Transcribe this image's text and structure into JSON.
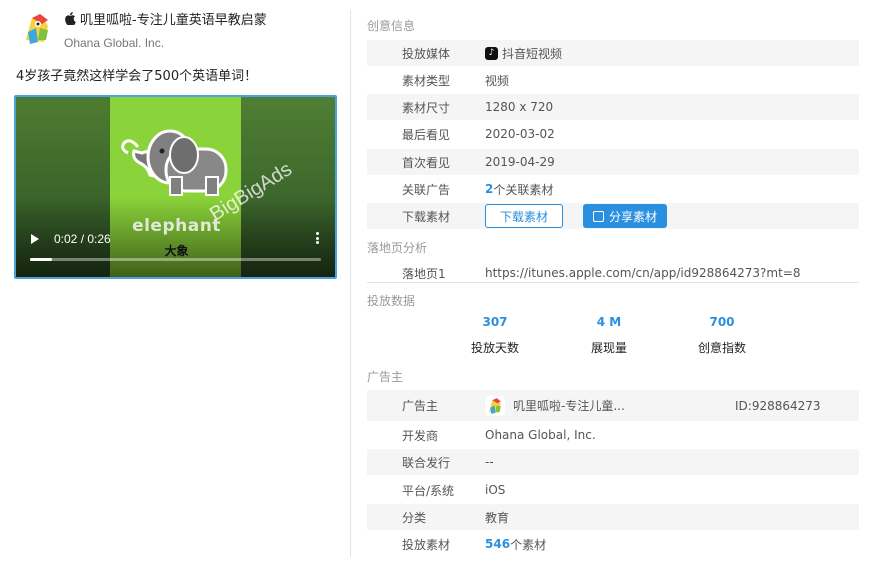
{
  "app": {
    "title": "叽里呱啦-专注儿童英语早教启蒙",
    "developer": "Ohana Global. Inc.",
    "ad_title": "4岁孩子竟然这样学会了500个英语单词！"
  },
  "video": {
    "time": "0:02 / 0:26",
    "progress": 0.077,
    "word_en": "elephant",
    "word_zh": "大象",
    "watermark": "BigBigAds"
  },
  "creative": {
    "section_title": "创意信息",
    "rows": [
      {
        "label": "投放媒体",
        "value": "抖音短视频"
      },
      {
        "label": "素材类型",
        "value": "视频"
      },
      {
        "label": "素材尺寸",
        "value": "1280 x 720"
      },
      {
        "label": "最后看见",
        "value": "2020-03-02"
      },
      {
        "label": "首次看见",
        "value": "2019-04-29"
      },
      {
        "label": "关联广告",
        "count": "2",
        "suffix": "个关联素材"
      },
      {
        "label": "下载素材",
        "download_btn": "下载素材",
        "share_btn": "分享素材"
      }
    ]
  },
  "landing": {
    "section_title": "落地页分析",
    "label": "落地页1",
    "url": "https://itunes.apple.com/cn/app/id928864273?mt=8"
  },
  "delivery": {
    "section_title": "投放数据",
    "stats": [
      {
        "value": "307",
        "label": "投放天数"
      },
      {
        "value": "4 M",
        "label": "展现量"
      },
      {
        "value": "700",
        "label": "创意指数"
      }
    ]
  },
  "advertiser": {
    "section_title": "广告主",
    "rows": [
      {
        "label": "广告主",
        "value": "叽里呱啦-专注儿童...",
        "id": "ID:928864273"
      },
      {
        "label": "开发商",
        "value": "Ohana Global, Inc."
      },
      {
        "label": "联合发行",
        "value": "--"
      },
      {
        "label": "平台/系统",
        "value": "iOS"
      },
      {
        "label": "分类",
        "value": "教育"
      },
      {
        "label": "投放素材",
        "count": "546",
        "suffix": "个素材"
      }
    ]
  },
  "colors": {
    "accent": "#2b8fe0",
    "row_shade": "#f5f5f5",
    "video_green": "#8bd33a"
  }
}
